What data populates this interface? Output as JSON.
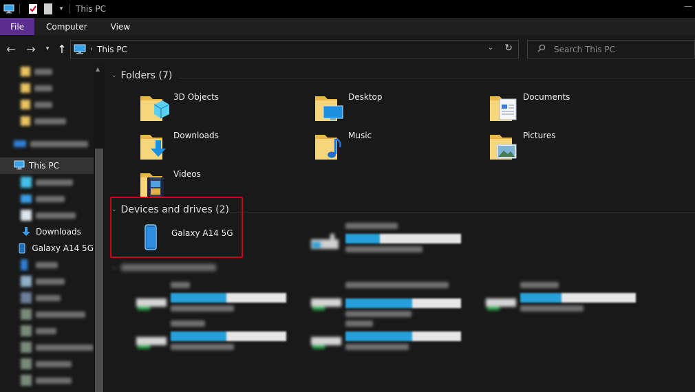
{
  "window": {
    "title": "This PC",
    "quick_access_icons": [
      "this-pc-icon",
      "properties-icon",
      "new-folder-icon",
      "customize-arrow-icon"
    ]
  },
  "ribbon": {
    "tabs": [
      {
        "label": "File",
        "active": true
      },
      {
        "label": "Computer"
      },
      {
        "label": "View"
      }
    ],
    "file_color": "#5c2d91"
  },
  "nav": {
    "back_icon": "back-arrow-icon",
    "forward_icon": "forward-arrow-icon",
    "recent_icon": "chevron-down-icon",
    "up_icon": "up-arrow-icon"
  },
  "address": {
    "location": "This PC",
    "separator": "›"
  },
  "search": {
    "placeholder": "Search This PC"
  },
  "sidebar": {
    "this_pc_label": "This PC",
    "downloads_label": "Downloads",
    "galaxy_label": "Galaxy A14 5G"
  },
  "folders_group": {
    "label": "Folders (7)",
    "items": [
      {
        "label": "3D Objects",
        "icon": "3d-objects-folder-icon"
      },
      {
        "label": "Desktop",
        "icon": "desktop-folder-icon"
      },
      {
        "label": "Documents",
        "icon": "documents-folder-icon"
      },
      {
        "label": "Downloads",
        "icon": "downloads-folder-icon"
      },
      {
        "label": "Music",
        "icon": "music-folder-icon"
      },
      {
        "label": "Pictures",
        "icon": "pictures-folder-icon"
      },
      {
        "label": "Videos",
        "icon": "videos-folder-icon"
      }
    ]
  },
  "devices_group": {
    "label": "Devices and drives (2)",
    "device_label": "Galaxy A14 5G",
    "device_icon": "phone-icon",
    "highlight_color": "#d0021b",
    "redacted_drive_fill": 0.3
  },
  "network_group": {
    "redacted": true,
    "drive_fills": [
      0.48,
      0.58,
      0.36,
      0.48,
      0.58
    ]
  },
  "colors": {
    "accent": "#26a0da",
    "background": "#191919"
  }
}
